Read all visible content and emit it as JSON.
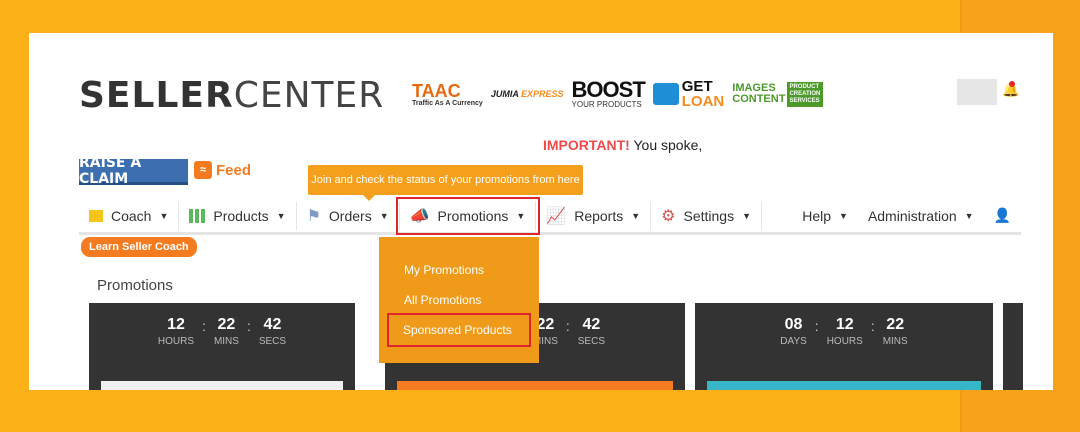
{
  "logo": {
    "bold": "SELLER",
    "light": "CENTER"
  },
  "brands": {
    "taac_title": "TAAC",
    "taac_sub": "Traffic As A Currency",
    "jumia": "JUMIA",
    "jumia_express": "EXPRESS",
    "boost_title": "BOOST",
    "boost_sub": "YOUR PRODUCTS",
    "loan_top": "GET",
    "loan_bottom": "LOAN",
    "images_top": "IMAGES",
    "images_bottom": "CONTENT",
    "images_box": "PRODUCT CREATION SERVICES"
  },
  "notice": {
    "important": "IMPORTANT!",
    "text": " You spoke,"
  },
  "raise_claim": "RAISE A CLAIM",
  "feed": "Feed",
  "tooltip": "Join and check the status of your promotions from here",
  "nav": {
    "coach": "Coach",
    "products": "Products",
    "orders": "Orders",
    "promotions": "Promotions",
    "reports": "Reports",
    "settings": "Settings",
    "help": "Help",
    "administration": "Administration"
  },
  "learn_coach": "Learn Seller Coach",
  "dropdown": [
    "My Promotions",
    "All Promotions",
    "Sponsored Products"
  ],
  "section_title": "Promotions",
  "timers": [
    {
      "a": "12",
      "al": "HOURS",
      "b": "22",
      "bl": "MINS",
      "c": "42",
      "cl": "SECS"
    },
    {
      "a": "22",
      "al": "MINS",
      "b": "42",
      "bl": "SECS"
    },
    {
      "a": "08",
      "al": "DAYS",
      "b": "12",
      "bl": "HOURS",
      "c": "22",
      "cl": "MINS"
    }
  ],
  "colors": {
    "accent": "#f47b20",
    "highlight": "#e0262a",
    "background": "#fbb017"
  }
}
